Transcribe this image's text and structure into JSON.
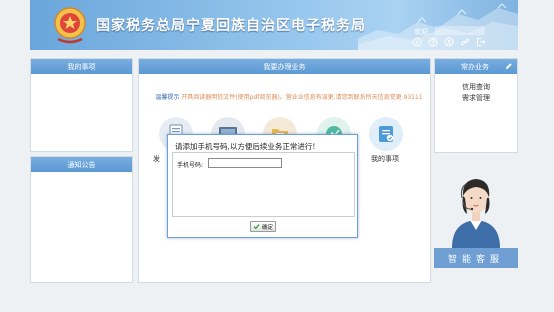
{
  "header": {
    "title": "国家税务总局宁夏回族自治区电子税务局",
    "welcome": "欢迎,",
    "icons": [
      "info-icon",
      "help-icon",
      "user-icon",
      "link-icon",
      "exit-icon"
    ]
  },
  "left_panels": {
    "my_items": "我的事项",
    "notices": "通知公告"
  },
  "center": {
    "title": "我要办理业务",
    "notice_label": "温馨提示",
    "notice_text": "开具阅读器明信文件(使用pdf阅览器)。营业业信息有误更,请您到联系所天信息变更 93111",
    "items": [
      {
        "label": "发",
        "icon": "document-icon"
      },
      {
        "label": "",
        "icon": "monitor-icon"
      },
      {
        "label": "",
        "icon": "folder-icon"
      },
      {
        "label": "",
        "icon": "chart-icon"
      },
      {
        "label": "我的事项",
        "icon": "checklist-icon"
      }
    ]
  },
  "right": {
    "title": "常办业务",
    "links": [
      "信用查询",
      "需求管理"
    ]
  },
  "service": {
    "button": "智能客服"
  },
  "modal": {
    "title": "请添加手机号码,以方便后续业务正常进行!",
    "phone_label": "手机号码:",
    "phone_value": "",
    "ok_label": "确定"
  },
  "colors": {
    "accent": "#5b98d3",
    "notice": "#e08b56",
    "modal_border": "#6ea0d8"
  }
}
